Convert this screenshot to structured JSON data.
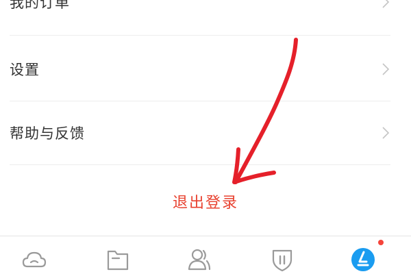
{
  "menu": {
    "items": [
      {
        "label": "我的订单",
        "icon": "chevron-right-icon"
      },
      {
        "label": "设置",
        "icon": "chevron-right-icon"
      },
      {
        "label": "帮助与反馈",
        "icon": "chevron-right-icon"
      }
    ]
  },
  "logout": {
    "label": "退出登录"
  },
  "tabbar": {
    "tabs": [
      {
        "icon": "cloud-icon"
      },
      {
        "icon": "folder-icon"
      },
      {
        "icon": "contacts-icon"
      },
      {
        "icon": "shield-icon"
      },
      {
        "icon": "profile-icon",
        "active": true,
        "has_badge": true
      }
    ]
  },
  "colors": {
    "logout_text": "#e8412f",
    "active_tab": "#1a9cf0",
    "inactive_tab": "#9a9a9a",
    "badge": "#f5443b",
    "annotation_arrow": "#e5202a"
  }
}
